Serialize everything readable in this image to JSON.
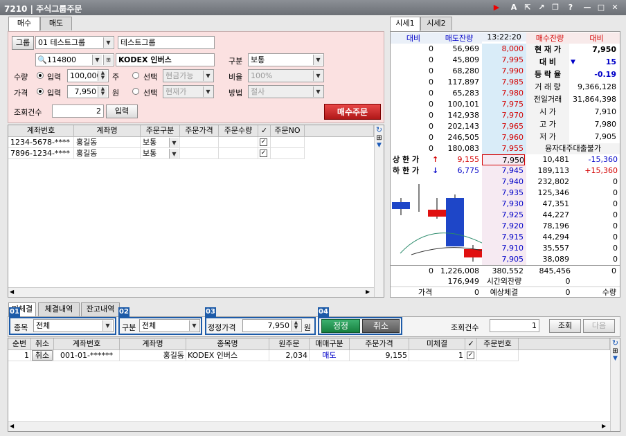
{
  "window": {
    "code": "7210",
    "title": "주식그룹주문"
  },
  "left_tabs": [
    "매수",
    "매도"
  ],
  "order": {
    "group_label": "그룹",
    "group_select": "01 테스트그룹",
    "group_name": "테스트그룹",
    "stock_code": "114800",
    "stock_name": "KODEX 인버스",
    "type_label": "구분",
    "type_value": "보통",
    "qty_label": "수량",
    "qty_mode": "입력",
    "qty_value": "100,000",
    "qty_unit": "주",
    "qty_select_label": "선택",
    "qty_select_value": "현금가능",
    "ratio_label": "비율",
    "ratio_value": "100%",
    "price_label": "가격",
    "price_mode": "입력",
    "price_value": "7,950",
    "price_unit": "원",
    "price_select_label": "선택",
    "price_select_value": "현재가",
    "method_label": "방법",
    "method_value": "절사",
    "count_label": "조회건수",
    "count_value": "2",
    "input_btn": "입력",
    "submit": "매수주문"
  },
  "account_grid": {
    "headers": [
      "계좌번호",
      "계좌명",
      "주문구분",
      "주문가격",
      "주문수량",
      "✓",
      "주문NO"
    ],
    "rows": [
      {
        "account": "1234-5678-****",
        "name": "홍길동",
        "type": "보통",
        "checked": "✓"
      },
      {
        "account": "7896-1234-****",
        "name": "홍길동",
        "type": "보통",
        "checked": "✓"
      }
    ]
  },
  "right_tabs": [
    "시세1",
    "시세2"
  ],
  "orderbook": {
    "headers": {
      "diff_l": "대비",
      "sell_qty": "매도잔량",
      "time": "13:22:20",
      "buy_qty": "매수잔량",
      "diff_r": "대비"
    },
    "asks": [
      {
        "diff": "0",
        "qty": "56,969",
        "price": "8,000"
      },
      {
        "diff": "0",
        "qty": "45,809",
        "price": "7,995"
      },
      {
        "diff": "0",
        "qty": "68,280",
        "price": "7,990"
      },
      {
        "diff": "0",
        "qty": "117,897",
        "price": "7,985"
      },
      {
        "diff": "0",
        "qty": "65,283",
        "price": "7,980"
      },
      {
        "diff": "0",
        "qty": "100,101",
        "price": "7,975"
      },
      {
        "diff": "0",
        "qty": "142,938",
        "price": "7,970"
      },
      {
        "diff": "0",
        "qty": "202,143",
        "price": "7,965"
      },
      {
        "diff": "0",
        "qty": "246,505",
        "price": "7,960"
      },
      {
        "diff": "0",
        "qty": "180,083",
        "price": "7,955"
      }
    ],
    "bids": [
      {
        "price": "7,950",
        "qty": "10,481",
        "diff": "-15,360"
      },
      {
        "price": "7,945",
        "qty": "189,113",
        "diff": "+15,360"
      },
      {
        "price": "7,940",
        "qty": "232,802",
        "diff": "0"
      },
      {
        "price": "7,935",
        "qty": "125,346",
        "diff": "0"
      },
      {
        "price": "7,930",
        "qty": "47,351",
        "diff": "0"
      },
      {
        "price": "7,925",
        "qty": "44,227",
        "diff": "0"
      },
      {
        "price": "7,920",
        "qty": "78,196",
        "diff": "0"
      },
      {
        "price": "7,915",
        "qty": "44,294",
        "diff": "0"
      },
      {
        "price": "7,910",
        "qty": "35,557",
        "diff": "0"
      },
      {
        "price": "7,905",
        "qty": "38,089",
        "diff": "0"
      }
    ],
    "info": [
      {
        "label": "현 재 가",
        "value": "7,950"
      },
      {
        "label": "대    비",
        "value": "15",
        "arrow": "▼"
      },
      {
        "label": "등 락 율",
        "value": "-0.19"
      },
      {
        "label": "거 래 량",
        "value": "9,366,128"
      },
      {
        "label": "전일거래",
        "value": "31,864,398"
      },
      {
        "label": "시    가",
        "value": "7,910"
      },
      {
        "label": "고    가",
        "value": "7,980"
      },
      {
        "label": "저    가",
        "value": "7,905"
      }
    ],
    "credit": "융자대주대출불가",
    "upper": {
      "label": "상 한 가",
      "arrow": "↑",
      "value": "9,155"
    },
    "lower": {
      "label": "하 한 가",
      "arrow": "↓",
      "value": "6,775"
    },
    "totals": {
      "diff": "0",
      "ask_total": "1,226,008",
      "mid": "380,552",
      "bid_total": "845,456",
      "diff_r": "0"
    },
    "after": {
      "val": "176,949",
      "label": "시간외잔량",
      "val2": "0"
    },
    "foot": {
      "price": "가격",
      "v1": "0",
      "exp": "예상체결",
      "v2": "0",
      "qty": "수량"
    }
  },
  "bottom_tabs": [
    "미체결",
    "체결내역",
    "잔고내역"
  ],
  "filters": {
    "n1": "01",
    "stock_label": "종목",
    "stock_value": "전체",
    "n2": "02",
    "type_label": "구분",
    "type_value": "전체",
    "n3": "03",
    "price_label": "정정가격",
    "price_value": "7,950",
    "price_unit": "원",
    "n4": "04",
    "modify": "정정",
    "cancel": "취소",
    "count_label": "조회건수",
    "count_value": "1",
    "query": "조회",
    "next": "다음"
  },
  "bottom_grid": {
    "headers": [
      "순번",
      "취소",
      "계좌번호",
      "계좌명",
      "종목명",
      "원주문",
      "매매구분",
      "주문가격",
      "미체결",
      "✓",
      "주문번호"
    ],
    "rows": [
      {
        "no": "1",
        "cancel": "취소",
        "account": "001-01-******",
        "name": "홍길동",
        "stock": "KODEX 인버스",
        "orig": "2,034",
        "side": "매도",
        "price": "9,155",
        "unfilled": "1",
        "checked": "✓",
        "order_no": ""
      }
    ]
  }
}
